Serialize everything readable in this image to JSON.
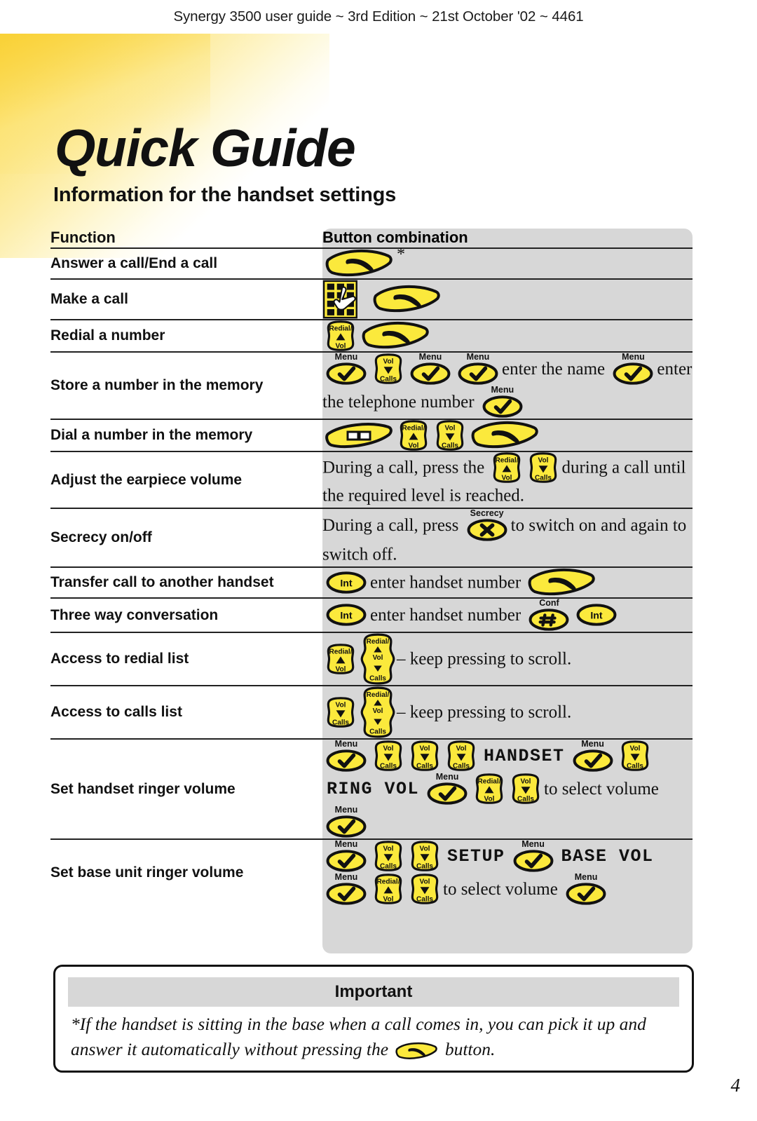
{
  "running_head": "Synergy 3500 user guide ~ 3rd Edition ~ 21st October '02 ~ 4461",
  "title": "Quick Guide",
  "subtitle": "Information for the handset settings",
  "table": {
    "headers": {
      "function": "Function",
      "combination": "Button combination"
    },
    "rows": [
      {
        "function": "Answer a call/End a call",
        "parts": [
          {
            "type": "key",
            "key": "talk",
            "label": ""
          },
          {
            "type": "text",
            "text": "*",
            "style": "asterisk"
          }
        ]
      },
      {
        "function": "Make a call",
        "parts": [
          {
            "type": "key",
            "key": "keypad",
            "label": ""
          },
          {
            "type": "key",
            "key": "talk",
            "label": ""
          }
        ]
      },
      {
        "function": "Redial a number",
        "parts": [
          {
            "type": "key",
            "key": "shield-up",
            "label": "Redial/ Vol"
          },
          {
            "type": "key",
            "key": "talk",
            "label": ""
          }
        ]
      },
      {
        "function": "Store a number in the memory",
        "parts": [
          {
            "type": "key",
            "key": "oval-tick",
            "label": "Menu"
          },
          {
            "type": "key",
            "key": "shield-down",
            "label": "Vol Calls"
          },
          {
            "type": "key",
            "key": "oval-tick",
            "label": "Menu"
          },
          {
            "type": "key",
            "key": "oval-tick",
            "label": "Menu"
          },
          {
            "type": "text",
            "text": "enter the name"
          },
          {
            "type": "key",
            "key": "oval-tick",
            "label": "Menu"
          },
          {
            "type": "text",
            "text": "enter the telephone number"
          },
          {
            "type": "key",
            "key": "oval-tick",
            "label": "Menu"
          }
        ]
      },
      {
        "function": "Dial a number in the memory",
        "parts": [
          {
            "type": "key",
            "key": "book",
            "label": ""
          },
          {
            "type": "key",
            "key": "shield-up",
            "label": "Redial/ Vol"
          },
          {
            "type": "key",
            "key": "shield-down",
            "label": "Vol Calls"
          },
          {
            "type": "key",
            "key": "talk",
            "label": ""
          }
        ]
      },
      {
        "function": "Adjust the earpiece volume",
        "parts": [
          {
            "type": "text",
            "text": "During a call, press the"
          },
          {
            "type": "key",
            "key": "shield-up",
            "label": "Redial/ Vol"
          },
          {
            "type": "key",
            "key": "shield-down",
            "label": "Vol Calls"
          },
          {
            "type": "text",
            "text": "during a call until the required level is reached."
          }
        ]
      },
      {
        "function": "Secrecy on/off",
        "parts": [
          {
            "type": "text",
            "text": "During a call, press"
          },
          {
            "type": "key",
            "key": "oval-x",
            "label": "Secrecy"
          },
          {
            "type": "text",
            "text": "to switch on and again to switch off."
          }
        ]
      },
      {
        "function": "Transfer call to another handset",
        "parts": [
          {
            "type": "key",
            "key": "oval-int",
            "label": ""
          },
          {
            "type": "text",
            "text": "enter handset number"
          },
          {
            "type": "key",
            "key": "talk",
            "label": ""
          }
        ]
      },
      {
        "function": "Three way conversation",
        "parts": [
          {
            "type": "key",
            "key": "oval-int",
            "label": ""
          },
          {
            "type": "text",
            "text": "enter handset number"
          },
          {
            "type": "key",
            "key": "oval-hash",
            "label": "Conf"
          },
          {
            "type": "key",
            "key": "oval-int",
            "label": ""
          }
        ]
      },
      {
        "function": "Access to redial list",
        "parts": [
          {
            "type": "key",
            "key": "shield-up",
            "label": "Redial/ Vol"
          },
          {
            "type": "key",
            "key": "shield-both",
            "label": "Redial/ Vol Calls"
          },
          {
            "type": "text",
            "text": "–  keep pressing to scroll."
          }
        ]
      },
      {
        "function": "Access to calls list",
        "parts": [
          {
            "type": "key",
            "key": "shield-down",
            "label": "Vol Calls"
          },
          {
            "type": "key",
            "key": "shield-both",
            "label": "Redial/ Vol Calls"
          },
          {
            "type": "text",
            "text": "–  keep pressing to scroll."
          }
        ]
      },
      {
        "function": "Set handset ringer volume",
        "parts": [
          {
            "type": "key",
            "key": "oval-tick",
            "label": "Menu"
          },
          {
            "type": "key",
            "key": "shield-down",
            "label": "Vol Calls"
          },
          {
            "type": "key",
            "key": "shield-down",
            "label": "Vol Calls"
          },
          {
            "type": "key",
            "key": "shield-down",
            "label": "Vol Calls"
          },
          {
            "type": "lcd",
            "text": "HANDSET"
          },
          {
            "type": "key",
            "key": "oval-tick",
            "label": "Menu"
          },
          {
            "type": "key",
            "key": "shield-down",
            "label": "Vol Calls"
          },
          {
            "type": "lcd",
            "text": "RING VOL"
          },
          {
            "type": "key",
            "key": "oval-tick",
            "label": "Menu"
          },
          {
            "type": "key",
            "key": "shield-up",
            "label": "Redial/ Vol"
          },
          {
            "type": "key",
            "key": "shield-down",
            "label": "Vol Calls"
          },
          {
            "type": "text",
            "text": "to select volume"
          },
          {
            "type": "key",
            "key": "oval-tick",
            "label": "Menu"
          }
        ]
      },
      {
        "function": "Set base unit ringer volume",
        "parts": [
          {
            "type": "key",
            "key": "oval-tick",
            "label": "Menu"
          },
          {
            "type": "key",
            "key": "shield-down",
            "label": "Vol Calls"
          },
          {
            "type": "key",
            "key": "shield-down",
            "label": "Vol Calls"
          },
          {
            "type": "lcd",
            "text": "SETUP"
          },
          {
            "type": "key",
            "key": "oval-tick",
            "label": "Menu"
          },
          {
            "type": "lcd",
            "text": "BASE VOL"
          },
          {
            "type": "key",
            "key": "oval-tick",
            "label": "Menu"
          },
          {
            "type": "key",
            "key": "shield-up",
            "label": "Redial/ Vol"
          },
          {
            "type": "key",
            "key": "shield-down",
            "label": "Vol Calls"
          },
          {
            "type": "text",
            "text": "to select volume"
          },
          {
            "type": "key",
            "key": "oval-tick",
            "label": "Menu"
          }
        ]
      }
    ]
  },
  "important": {
    "heading": "Important",
    "body_before": "*If the handset is sitting in the base when a call comes in, you can pick it up and answer it automatically without pressing the",
    "body_after": "button."
  },
  "page_number": "4",
  "colors": {
    "key_yellow": "#FBE93C",
    "key_outline": "#111111",
    "column_gray": "#D7D7D7",
    "accent_yellow": "#F9D135"
  },
  "key_labels": {
    "menu": "Menu",
    "secrecy": "Secrecy",
    "conf": "Conf",
    "int": "Int",
    "redial": "Redial/",
    "vol": "Vol",
    "calls": "Calls"
  }
}
